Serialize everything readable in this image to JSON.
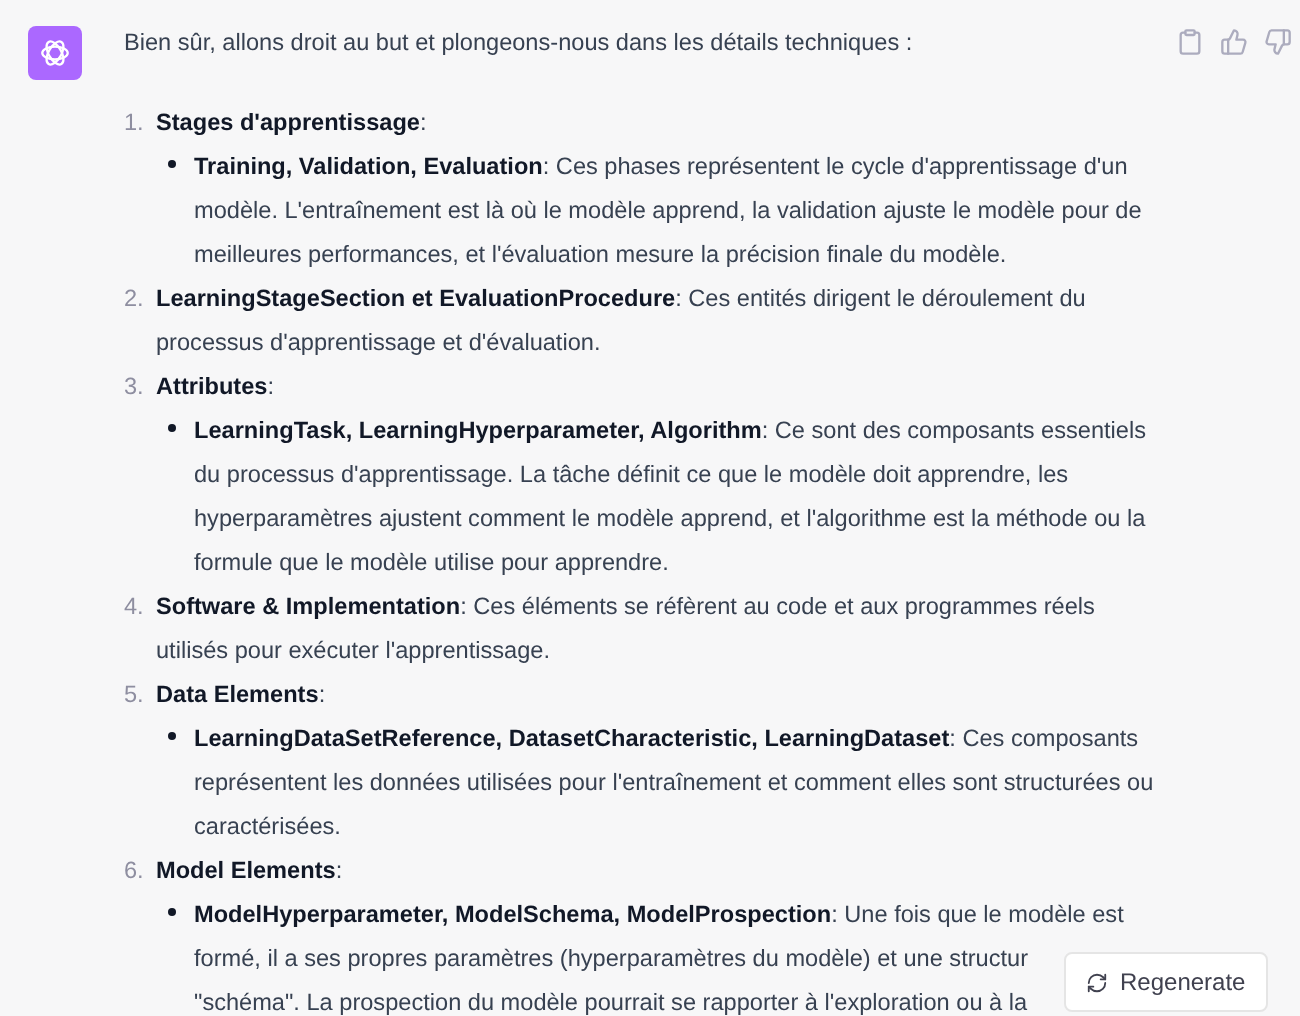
{
  "message": {
    "intro": "Bien sûr, allons droit au but et plongeons-nous dans les détails techniques :",
    "items": [
      {
        "number": "1.",
        "text": "**Stages d'apprentissage**:",
        "children": [
          {
            "text": "**Training, Validation, Evaluation**: Ces phases représentent le cycle d'apprentissage d'un modèle. L'entraînement est là où le modèle apprend, la validation ajuste le modèle pour de meilleures performances, et l'évaluation mesure la précision finale du modèle."
          }
        ]
      },
      {
        "number": "2.",
        "text": "**LearningStageSection et EvaluationProcedure**: Ces entités dirigent le déroulement du processus d'apprentissage et d'évaluation."
      },
      {
        "number": "3.",
        "text": "**Attributes**:",
        "children": [
          {
            "text": "**LearningTask, LearningHyperparameter, Algorithm**: Ce sont des composants essentiels du processus d'apprentissage. La tâche définit ce que le modèle doit apprendre, les hyperparamètres ajustent comment le modèle apprend, et l'algorithme est la méthode ou la formule que le modèle utilise pour apprendre."
          }
        ]
      },
      {
        "number": "4.",
        "text": "**Software & Implementation**: Ces éléments se réfèrent au code et aux programmes réels utilisés pour exécuter l'apprentissage."
      },
      {
        "number": "5.",
        "text": "**Data Elements**:",
        "children": [
          {
            "text": "**LearningDataSetReference, DatasetCharacteristic, LearningDataset**: Ces composants représentent les données utilisées pour l'entraînement et comment elles sont structurées ou caractérisées."
          }
        ]
      },
      {
        "number": "6.",
        "text": "**Model Elements**:",
        "children": [
          {
            "lines": [
              "**ModelHyperparameter, ModelSchema, ModelProspection**: Une fois que le modèle est",
              "formé, il a ses propres paramètres (hyperparamètres du modèle) et une structur",
              "\"schéma\". La prospection du modèle pourrait se rapporter à l'exploration ou à la"
            ]
          }
        ]
      }
    ]
  },
  "regenerate_button": {
    "label": "Regenerate"
  }
}
